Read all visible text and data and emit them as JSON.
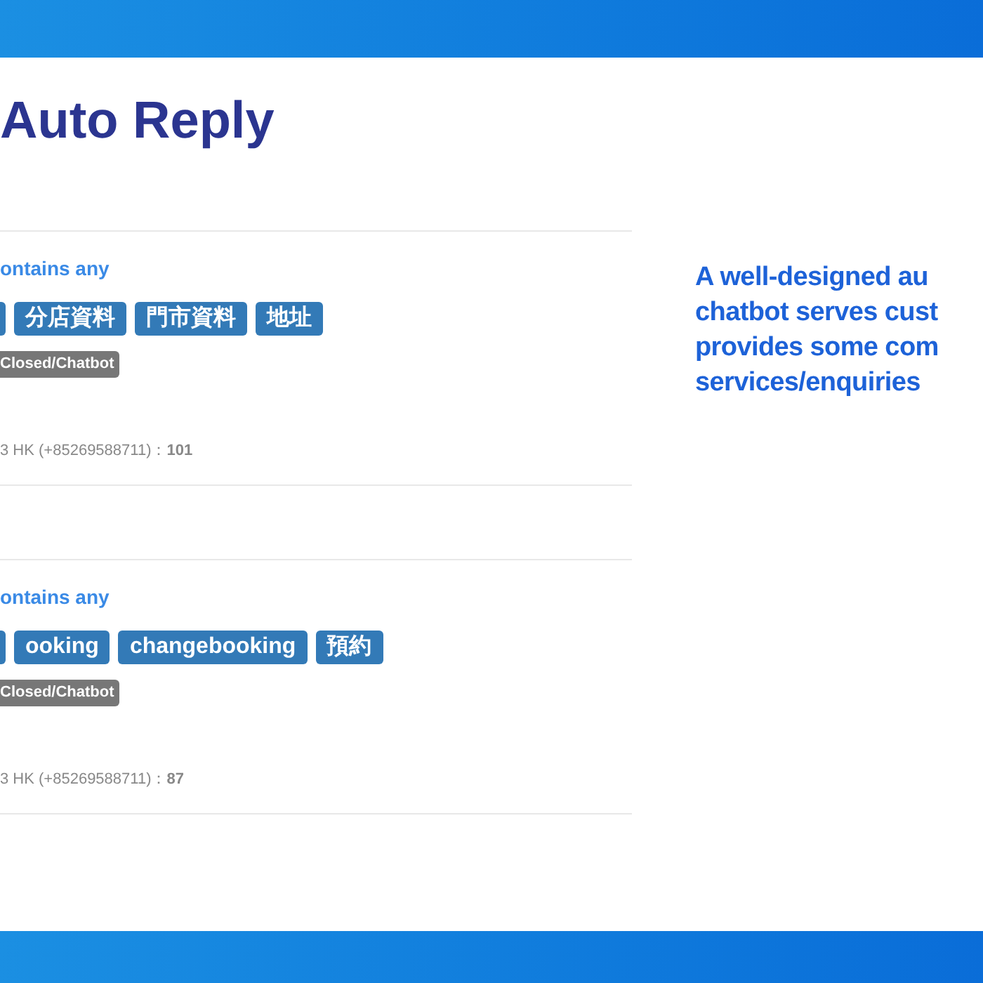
{
  "title": "Auto Reply",
  "rules": [
    {
      "condition": "ontains any",
      "keywords": [
        "分店資料",
        "門市資料",
        "地址"
      ],
      "status": "Closed/Chatbot",
      "footer": "3 HK (+85269588711)：**101**"
    },
    {
      "condition": "ontains any",
      "keywords": [
        "ooking",
        "changebooking",
        "預約"
      ],
      "status": "Closed/Chatbot",
      "footer": "3 HK (+85269588711)：**87**"
    }
  ],
  "caption": [
    "A well-designed au",
    "chatbot serves cust",
    "provides some com",
    "services/enquiries"
  ]
}
